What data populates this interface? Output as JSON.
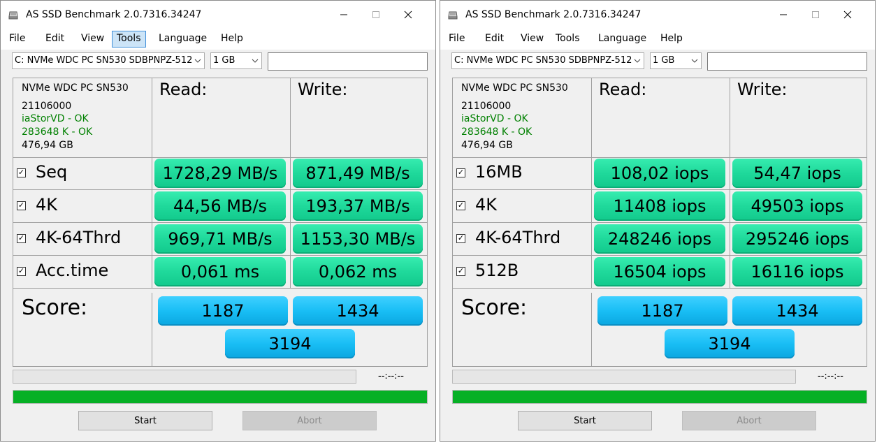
{
  "colors": {
    "accent_green": "#06b025",
    "value_green": "#1fd99b",
    "score_blue": "#19bef5",
    "ok_text": "#008000"
  },
  "windows": [
    {
      "title": "AS SSD Benchmark 2.0.7316.34247",
      "menu": [
        "File",
        "Edit",
        "View",
        "Tools",
        "Language",
        "Help"
      ],
      "active_menu_index": 3,
      "drive_select": "C: NVMe WDC PC SN530 SDBPNPZ-512",
      "size_select": "1 GB",
      "text_field": "",
      "info": {
        "model": "NVMe WDC PC SN530",
        "firmware": "21106000",
        "driver": "iaStorVD - OK",
        "alignment": "283648 K - OK",
        "capacity": "476,94 GB"
      },
      "read_header": "Read:",
      "write_header": "Write:",
      "rows": [
        {
          "label": "Seq",
          "read": "1728,29 MB/s",
          "write": "871,49 MB/s",
          "checked": true
        },
        {
          "label": "4K",
          "read": "44,56 MB/s",
          "write": "193,37 MB/s",
          "checked": true
        },
        {
          "label": "4K-64Thrd",
          "read": "969,71 MB/s",
          "write": "1153,30 MB/s",
          "checked": true
        },
        {
          "label": "Acc.time",
          "read": "0,061 ms",
          "write": "0,062 ms",
          "checked": true
        }
      ],
      "score_label": "Score:",
      "score_read": "1187",
      "score_write": "1434",
      "score_total": "3194",
      "time": "--:--:--",
      "progress": 1.0,
      "start_label": "Start",
      "abort_label": "Abort"
    },
    {
      "title": "AS SSD Benchmark 2.0.7316.34247",
      "menu": [
        "File",
        "Edit",
        "View",
        "Tools",
        "Language",
        "Help"
      ],
      "active_menu_index": -1,
      "drive_select": "C: NVMe WDC PC SN530 SDBPNPZ-512",
      "size_select": "1 GB",
      "text_field": "",
      "info": {
        "model": "NVMe WDC PC SN530",
        "firmware": "21106000",
        "driver": "iaStorVD - OK",
        "alignment": "283648 K - OK",
        "capacity": "476,94 GB"
      },
      "read_header": "Read:",
      "write_header": "Write:",
      "rows": [
        {
          "label": "16MB",
          "read": "108,02 iops",
          "write": "54,47 iops",
          "checked": true
        },
        {
          "label": "4K",
          "read": "11408 iops",
          "write": "49503 iops",
          "checked": true
        },
        {
          "label": "4K-64Thrd",
          "read": "248246 iops",
          "write": "295246 iops",
          "checked": true
        },
        {
          "label": "512B",
          "read": "16504 iops",
          "write": "16116 iops",
          "checked": true
        }
      ],
      "score_label": "Score:",
      "score_read": "1187",
      "score_write": "1434",
      "score_total": "3194",
      "time": "--:--:--",
      "progress": 1.0,
      "start_label": "Start",
      "abort_label": "Abort"
    }
  ]
}
